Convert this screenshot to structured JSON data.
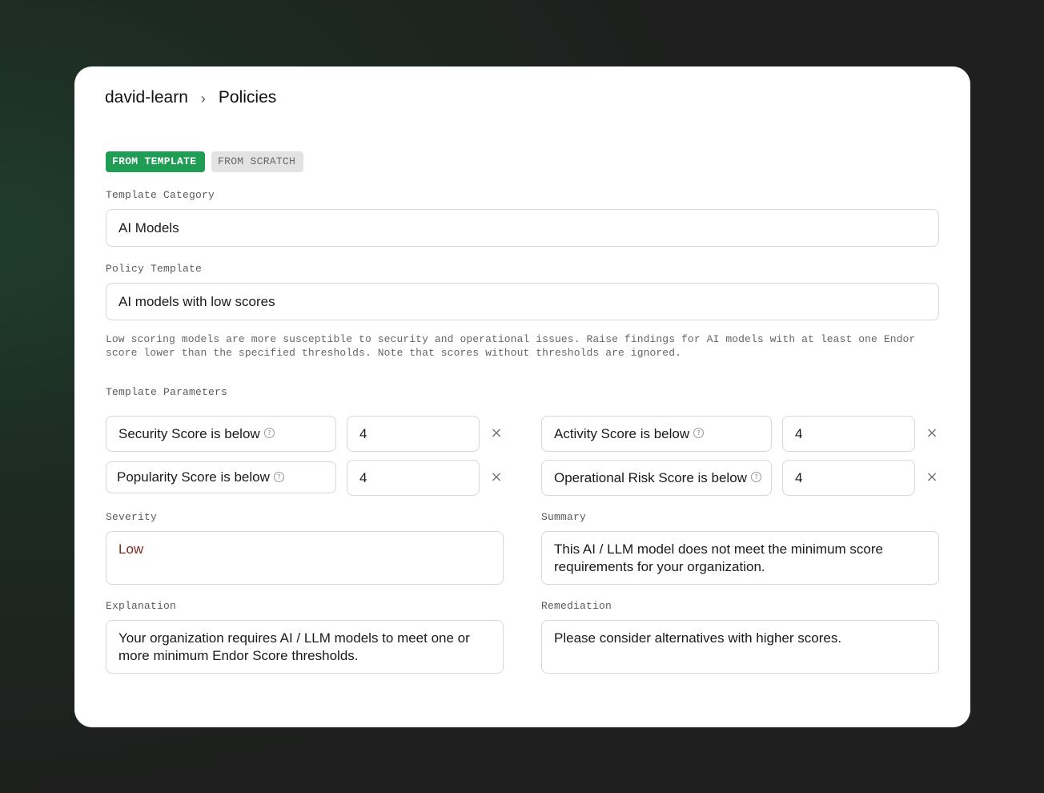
{
  "breadcrumb": {
    "org": "david-learn",
    "separator": "›",
    "page": "Policies"
  },
  "mode_tabs": {
    "from_template": "FROM TEMPLATE",
    "from_scratch": "FROM SCRATCH",
    "active": "from_template"
  },
  "template_category": {
    "label": "Template Category",
    "value": "AI Models"
  },
  "policy_template": {
    "label": "Policy Template",
    "value": "AI models with low scores"
  },
  "description": {
    "line1": "Low scoring models are more susceptible to security and operational issues. Raise findings for AI models with at least one Endor",
    "line2": "score lower than the specified thresholds. Note that scores without thresholds are ignored."
  },
  "template_parameters": {
    "label": "Template Parameters",
    "items": [
      {
        "name": "Security Score is below",
        "value": "4"
      },
      {
        "name": "Activity Score is below",
        "value": "4"
      },
      {
        "name": "Popularity Score is below",
        "value": "4"
      },
      {
        "name": "Operational Risk Score is below",
        "value": "4"
      }
    ],
    "info_glyph": "?",
    "remove_glyph": "×"
  },
  "severity": {
    "label": "Severity",
    "value": "Low",
    "color": "#7a2a1a"
  },
  "summary": {
    "label": "Summary",
    "value": "This AI / LLM model does not meet the minimum score requirements for your organization."
  },
  "explanation": {
    "label": "Explanation",
    "value": "Your organization requires AI / LLM models to meet one or more minimum Endor Score thresholds."
  },
  "remediation": {
    "label": "Remediation",
    "value": "Please consider alternatives with higher scores."
  },
  "colors": {
    "accent": "#1f9d55",
    "background": "#1e2a23",
    "card": "#ffffff"
  }
}
